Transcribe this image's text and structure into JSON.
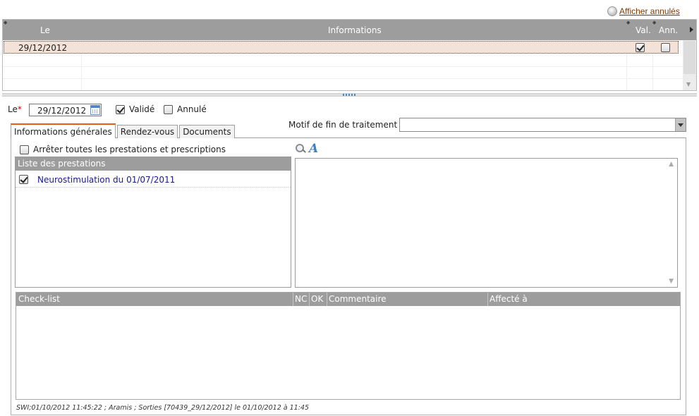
{
  "show_cancelled": {
    "label": "Afficher annulés"
  },
  "grid": {
    "columns": {
      "le": "Le",
      "informations": "Informations",
      "val": "Val.",
      "ann": "Ann."
    },
    "rows": [
      {
        "date": "29/12/2012",
        "validated": true,
        "cancelled": false
      }
    ]
  },
  "form": {
    "le_label": "Le",
    "required_mark": "*",
    "date_value": "29/12/2012",
    "valide_label": "Validé",
    "valide_checked": true,
    "annule_label": "Annulé",
    "annule_checked": false
  },
  "tabs": [
    {
      "label": "Informations générales",
      "active": true
    },
    {
      "label": "Rendez-vous",
      "active": false
    },
    {
      "label": "Documents",
      "active": false
    }
  ],
  "motif": {
    "label": "Motif de fin de traitement",
    "value": ""
  },
  "general": {
    "stop_all_label": "Arrêter toutes les prestations et prescriptions",
    "stop_all_checked": false,
    "prestations_header": "Liste des prestations",
    "prestations": [
      {
        "label": "Neurostimulation du 01/07/2011",
        "checked": true
      }
    ]
  },
  "checklist": {
    "columns": {
      "checklist": "Check-list",
      "nc": "NC",
      "ok": "OK",
      "commentaire": "Commentaire",
      "affecte": "Affecté à"
    }
  },
  "footer": {
    "audit": "SWI;01/10/2012 11:45:22 ; Aramis ; Sorties [70439_29/12/2012] le 01/10/2012 à 11:45"
  },
  "colors": {
    "header_bg": "#9d9d9d",
    "row_selected": "#f2e2d7",
    "tab_accent": "#e55b17",
    "link": "#7a3b00",
    "prestation_text": "#1a1a8a"
  }
}
